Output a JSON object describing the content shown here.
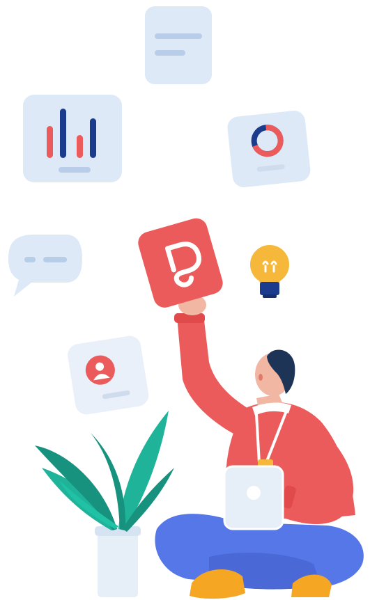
{
  "illustration": {
    "colors": {
      "card": "#dde9f6",
      "card_line": "#b7cde8",
      "navy": "#1b3c8c",
      "coral": "#ec5b5b",
      "coral_dark": "#e04a4a",
      "teal": "#1fb39a",
      "teal_dark": "#17927e",
      "blue_pants": "#5577e8",
      "skin": "#f2b7a3",
      "hair": "#1e3457",
      "shoe": "#f5a623",
      "bulb": "#f5b83a",
      "bulb_base": "#1b3c8c",
      "pot": "#e6eef8"
    },
    "icons": [
      "document-card-icon",
      "bar-chart-card-icon",
      "donut-chart-card-icon",
      "chat-bubble-icon",
      "app-logo-card-icon",
      "lightbulb-icon",
      "user-profile-card-icon",
      "potted-plant-icon",
      "person-sitting-icon",
      "tablet-device-icon"
    ]
  }
}
